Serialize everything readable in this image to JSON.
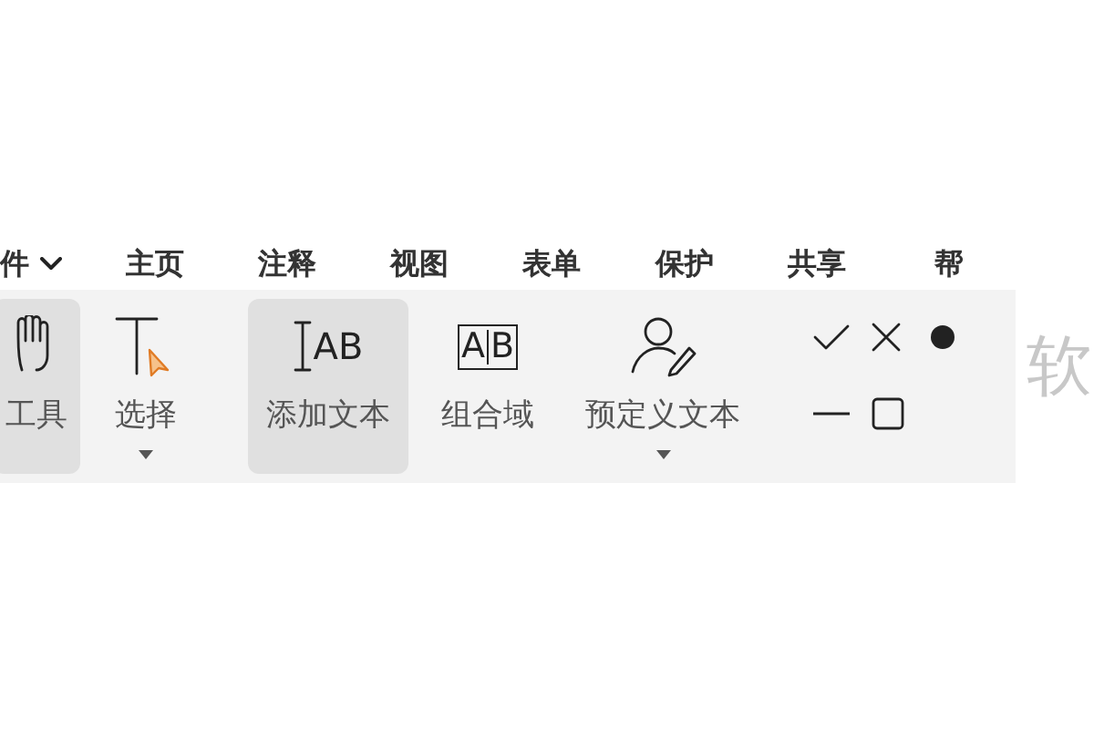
{
  "menu": [
    {
      "label": "件",
      "dropdown": true
    },
    {
      "label": "主页",
      "dropdown": false
    },
    {
      "label": "注释",
      "dropdown": false
    },
    {
      "label": "视图",
      "dropdown": false
    },
    {
      "label": "表单",
      "dropdown": false
    },
    {
      "label": "保护",
      "dropdown": false
    },
    {
      "label": "共享",
      "dropdown": false
    },
    {
      "label": "帮",
      "dropdown": false
    }
  ],
  "tools": [
    {
      "kind": "hand",
      "label": "工具",
      "selected": true,
      "dropdown": false
    },
    {
      "kind": "select",
      "label": "选择",
      "selected": false,
      "dropdown": true
    },
    {
      "kind": "divider"
    },
    {
      "kind": "text",
      "icon_text": "AB",
      "label": "添加文本",
      "selected": true,
      "dropdown": false
    },
    {
      "kind": "field",
      "icon_text": "AB",
      "label": "组合域",
      "selected": false,
      "dropdown": false
    },
    {
      "kind": "predefined",
      "label": "预定义文本",
      "selected": false,
      "dropdown": true
    },
    {
      "kind": "divider"
    },
    {
      "kind": "marks"
    },
    {
      "kind": "divider"
    }
  ],
  "side_text": "软"
}
